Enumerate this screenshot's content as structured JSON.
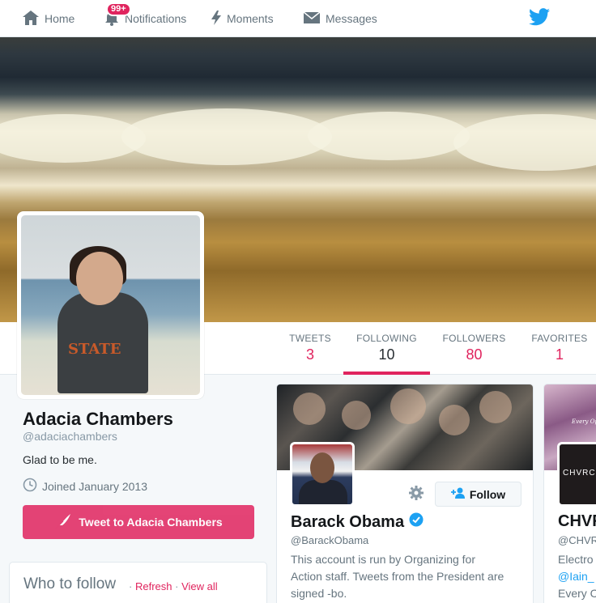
{
  "nav": {
    "home": "Home",
    "notifications": "Notifications",
    "notifications_badge": "99+",
    "moments": "Moments",
    "messages": "Messages"
  },
  "stats": [
    {
      "label": "TWEETS",
      "value": "3"
    },
    {
      "label": "FOLLOWING",
      "value": "10"
    },
    {
      "label": "FOLLOWERS",
      "value": "80"
    },
    {
      "label": "FAVORITES",
      "value": "1"
    }
  ],
  "profile": {
    "name": "Adacia Chambers",
    "handle": "@adaciachambers",
    "bio": "Glad to be me.",
    "joined": "Joined January 2013",
    "tweet_to": "Tweet to Adacia Chambers",
    "avatar_shirt_text": "STATE"
  },
  "who_to_follow": {
    "title": "Who to follow",
    "separator": "·",
    "refresh": "Refresh",
    "view_all": "View all"
  },
  "cards": [
    {
      "name": "Barack Obama",
      "handle": "@BarackObama",
      "bio": "This account is run by Organizing for Action staff. Tweets from the President are signed -bo.",
      "follow": "Follow"
    },
    {
      "name": "CHVRCHES",
      "handle": "@CHVRCHES",
      "bio_line1": "Electro",
      "bio_mention": "@Iain_",
      "bio_line3": "Every C",
      "avatar_text": "CHVRC",
      "banner_text": "Every Op"
    }
  ],
  "colors": {
    "accent": "#e0245e",
    "twitter_blue": "#1da1f2"
  }
}
